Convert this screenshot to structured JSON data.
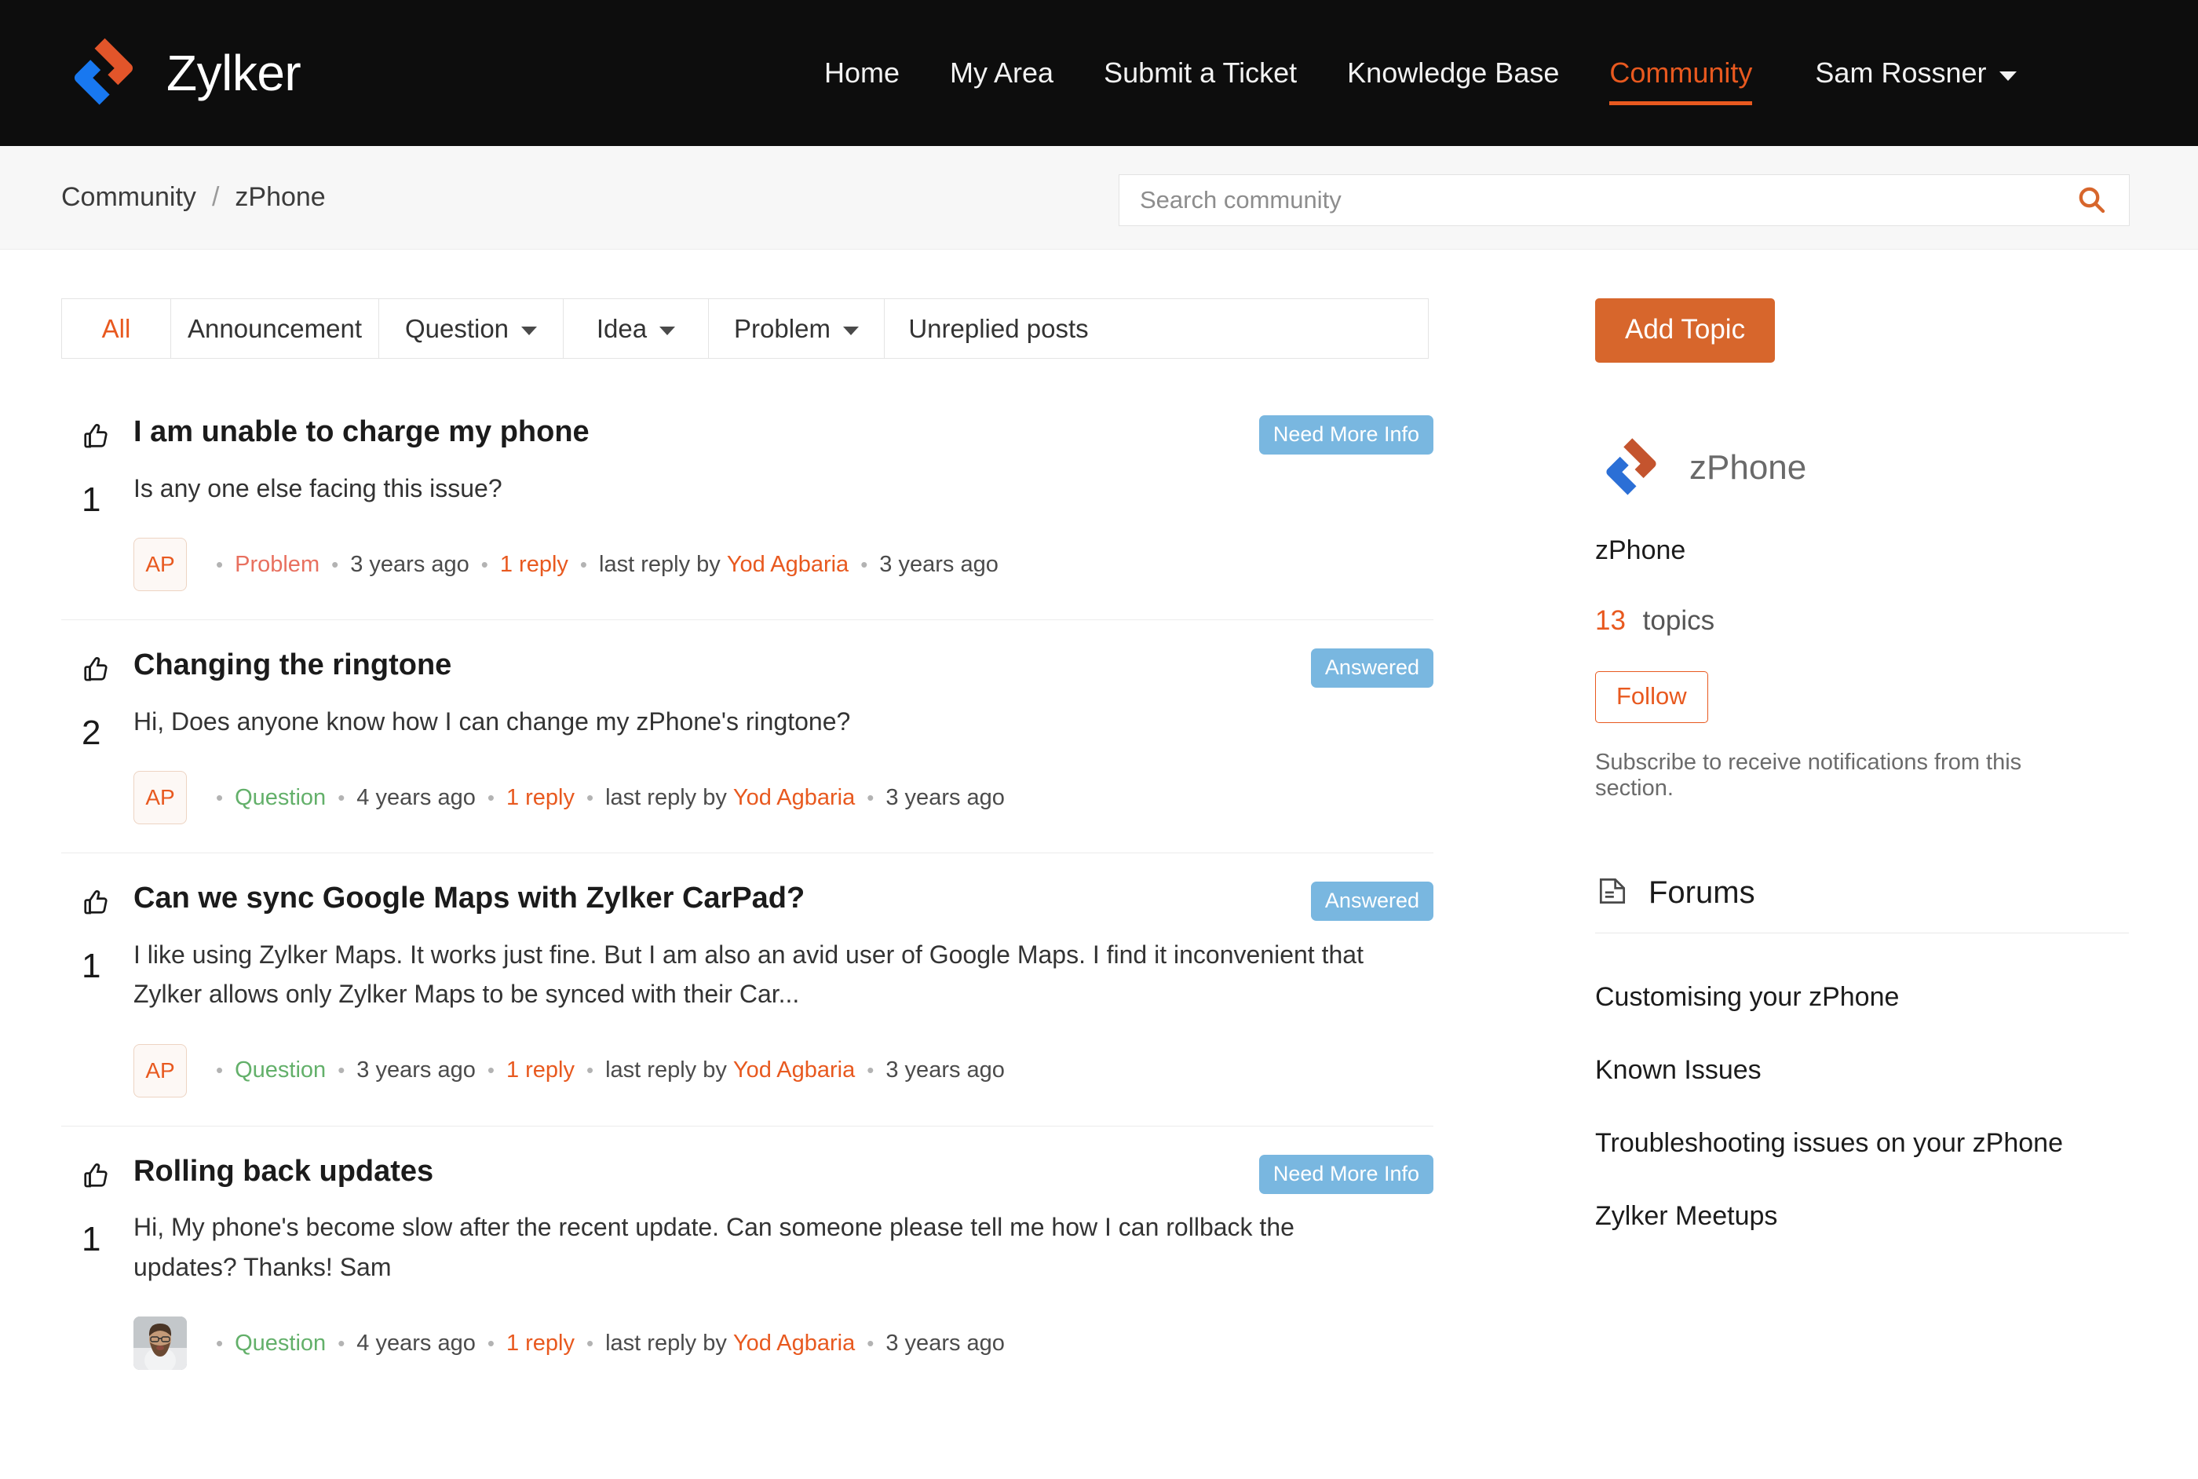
{
  "header": {
    "brand_name": "Zylker",
    "logo_icon": "zylker-logo-icon",
    "nav": [
      {
        "label": "Home",
        "active": false
      },
      {
        "label": "My Area",
        "active": false
      },
      {
        "label": "Submit a Ticket",
        "active": false
      },
      {
        "label": "Knowledge Base",
        "active": false
      },
      {
        "label": "Community",
        "active": true
      }
    ],
    "user": {
      "name": "Sam Rossner",
      "caret_icon": "chevron-down-icon"
    },
    "accent_color": "#e8591f",
    "background_color": "#0d0d0d"
  },
  "breadcrumb": {
    "items": [
      "Community",
      "zPhone"
    ],
    "separator": "/"
  },
  "search": {
    "placeholder": "Search community",
    "value": "",
    "icon": "search-icon",
    "icon_color": "#d7662c"
  },
  "filters": {
    "tabs": [
      {
        "label": "All",
        "active": true,
        "has_chevron": false
      },
      {
        "label": "Announcement",
        "active": false,
        "has_chevron": false
      },
      {
        "label": "Question",
        "active": false,
        "has_chevron": true
      },
      {
        "label": "Idea",
        "active": false,
        "has_chevron": true
      },
      {
        "label": "Problem",
        "active": false,
        "has_chevron": true
      },
      {
        "label": "Unreplied posts",
        "active": false,
        "has_chevron": false
      }
    ]
  },
  "posts": [
    {
      "vote_icon": "thumbs-up-icon",
      "votes": "1",
      "title": "I am unable to charge my phone",
      "snippet": "Is any one else facing this issue?",
      "badge": "Need More Info",
      "badge_color": "#79b7e0",
      "avatar_type": "initials",
      "avatar_initials": "AP",
      "type": "Problem",
      "type_style": "problem",
      "posted_ago": "3 years ago",
      "replies": "1 reply",
      "last_reply_prefix": "last reply by",
      "last_reply_author": "Yod Agbaria",
      "last_reply_ago": "3 years ago"
    },
    {
      "vote_icon": "thumbs-up-icon",
      "votes": "2",
      "title": "Changing the ringtone",
      "snippet": "Hi, Does anyone know how I can change my zPhone's ringtone?",
      "badge": "Answered",
      "badge_color": "#79b7e0",
      "avatar_type": "initials",
      "avatar_initials": "AP",
      "type": "Question",
      "type_style": "question",
      "posted_ago": "4 years ago",
      "replies": "1 reply",
      "last_reply_prefix": "last reply by",
      "last_reply_author": "Yod Agbaria",
      "last_reply_ago": "3 years ago"
    },
    {
      "vote_icon": "thumbs-up-icon",
      "votes": "1",
      "title": "Can we sync Google Maps with Zylker CarPad?",
      "snippet": "I like using Zylker Maps. It works just fine. But I am also an avid user of Google Maps. I find it inconvenient that Zylker allows only Zylker Maps to be synced with their Car...",
      "badge": "Answered",
      "badge_color": "#79b7e0",
      "avatar_type": "initials",
      "avatar_initials": "AP",
      "type": "Question",
      "type_style": "question",
      "posted_ago": "3 years ago",
      "replies": "1 reply",
      "last_reply_prefix": "last reply by",
      "last_reply_author": "Yod Agbaria",
      "last_reply_ago": "3 years ago"
    },
    {
      "vote_icon": "thumbs-up-icon",
      "votes": "1",
      "title": "Rolling back updates",
      "snippet": "Hi, My phone's become slow after the recent update. Can someone please tell me how I can rollback the updates? Thanks! Sam",
      "badge": "Need More Info",
      "badge_color": "#79b7e0",
      "avatar_type": "photo",
      "avatar_initials": "",
      "type": "Question",
      "type_style": "question",
      "posted_ago": "4 years ago",
      "replies": "1 reply",
      "last_reply_prefix": "last reply by",
      "last_reply_author": "Yod Agbaria",
      "last_reply_ago": "3 years ago"
    }
  ],
  "sidebar": {
    "add_topic_label": "Add Topic",
    "forum_logo_icon": "zylker-logo-icon",
    "forum_name": "zPhone",
    "forum_subtitle": "zPhone",
    "topics_count": "13",
    "topics_label": "topics",
    "follow_label": "Follow",
    "subscribe_note": "Subscribe to receive notifications from this section.",
    "forums_title": "Forums",
    "forums_icon": "document-list-icon",
    "forums": [
      "Customising your zPhone",
      "Known Issues",
      "Troubleshooting issues on your zPhone",
      "Zylker Meetups"
    ]
  }
}
